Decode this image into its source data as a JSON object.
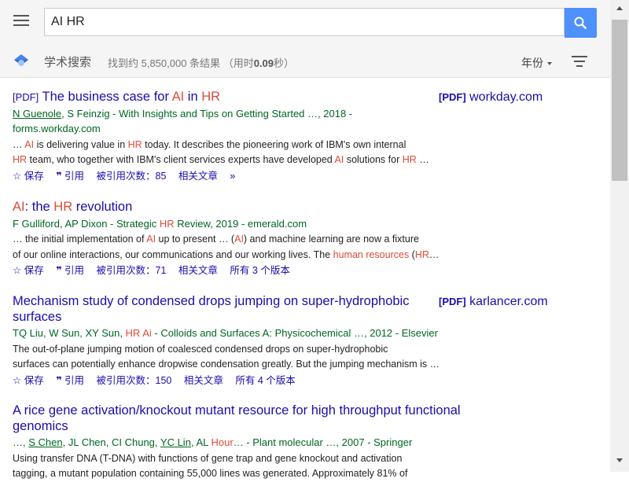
{
  "search": {
    "query": "AI HR"
  },
  "header": {
    "brand": "学术搜索",
    "stats_prefix": "找到约 5,850,000 条结果",
    "stats_time_open": "（用时",
    "stats_time": "0.09",
    "stats_time_close": "秒）",
    "year_filter": "年份"
  },
  "actions": {
    "save": "保存",
    "cite": "引用"
  },
  "results": [
    {
      "tag": "[PDF]",
      "title_parts": [
        "The business case for ",
        "AI",
        " in ",
        "HR"
      ],
      "authors": [
        "N Guenole",
        ", S Feinzig - With Insights and Tips on Getting Started …, 2018 -"
      ],
      "source_line2": "forms.workday.com",
      "snippet1": [
        "… ",
        "AI",
        " is delivering value in ",
        "HR",
        " today. It describes the pioneering work of IBM's own internal"
      ],
      "snippet2": [
        "HR",
        " team, who together with IBM's client services experts have developed ",
        "AI",
        " solutions for ",
        "HR",
        " …"
      ],
      "cited": "被引用次数：85",
      "related": "相关文章",
      "side_tag": "[PDF]",
      "side_domain": "workday.com"
    },
    {
      "title_parts": [
        "AI",
        ": the ",
        "HR",
        " revolution"
      ],
      "authors": [
        "F Gulliford, AP Dixon - Strategic ",
        "HR",
        " Review, 2019 - emerald.com"
      ],
      "snippet1": [
        "… the initial implementation of ",
        "AI",
        " up to present … (",
        "AI",
        ") and machine learning are now a fixture"
      ],
      "snippet2": [
        "of our online interactions, our communications and our working lives. The ",
        "human resources",
        " (",
        "HR",
        "…"
      ],
      "cited": "被引用次数：71",
      "related": "相关文章",
      "versions": "所有 3 个版本"
    },
    {
      "title_line1": "Mechanism study of condensed drops jumping on super-hydrophobic",
      "title_line2": "surfaces",
      "authors": [
        "TQ Liu, W Sun, XY Sun, ",
        "HR Ai",
        " - Colloids and Surfaces A: Physicochemical …, 2012 - Elsevier"
      ],
      "snippet1": "The out-of-plane jumping motion of coalesced condensed drops on super-hydrophobic",
      "snippet2": "surfaces can potentially enhance dropwise condensation greatly. But the jumping mechanism is …",
      "cited": "被引用次数：150",
      "related": "相关文章",
      "versions": "所有 4 个版本",
      "side_tag": "[PDF]",
      "side_domain": "karlancer.com"
    },
    {
      "title_line1": "A rice gene activation/knockout mutant resource for high throughput functional",
      "title_line2": "genomics",
      "authors": [
        "…, ",
        "S Chen",
        ", JL Chen, CI Chung, ",
        "YC Lin",
        ", AL ",
        "Hour",
        "… - Plant molecular …, 2007 - Springer"
      ],
      "snippet1": "Using transfer DNA (T-DNA) with functions of gene trap and gene knockout and activation",
      "snippet2": "tagging, a mutant population containing 55,000 lines was generated. Approximately 81% of"
    }
  ]
}
